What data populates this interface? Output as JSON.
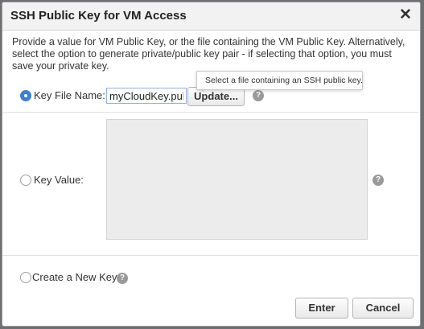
{
  "dialog": {
    "title": "SSH Public Key for VM Access",
    "close_symbol": "✕",
    "description": "Provide a value for VM Public Key, or the file containing the VM Public Key. Alternatively, select the option to generate private/public key pair - if selecting that option, you must save your private key."
  },
  "options": {
    "key_file": {
      "label": "Key File Name:",
      "selected": true,
      "value": "myCloudKey.pub",
      "update_label": "Update...",
      "help_symbol": "?"
    },
    "key_value": {
      "label": "Key Value:",
      "selected": false,
      "value": "",
      "help_symbol": "?"
    },
    "new_key": {
      "label": "Create a New Key",
      "selected": false,
      "help_symbol": "?"
    }
  },
  "tooltip": {
    "text": "Select a file containing an SSH public key."
  },
  "buttons": {
    "enter_label": "Enter",
    "cancel_label": "Cancel"
  },
  "icons": {
    "close": "close-icon",
    "help": "help-icon",
    "resize": "resize-handle-icon"
  },
  "colors": {
    "accent": "#3d7fcf",
    "backdrop": "#6d6f72",
    "textarea_bg": "#ececec"
  }
}
